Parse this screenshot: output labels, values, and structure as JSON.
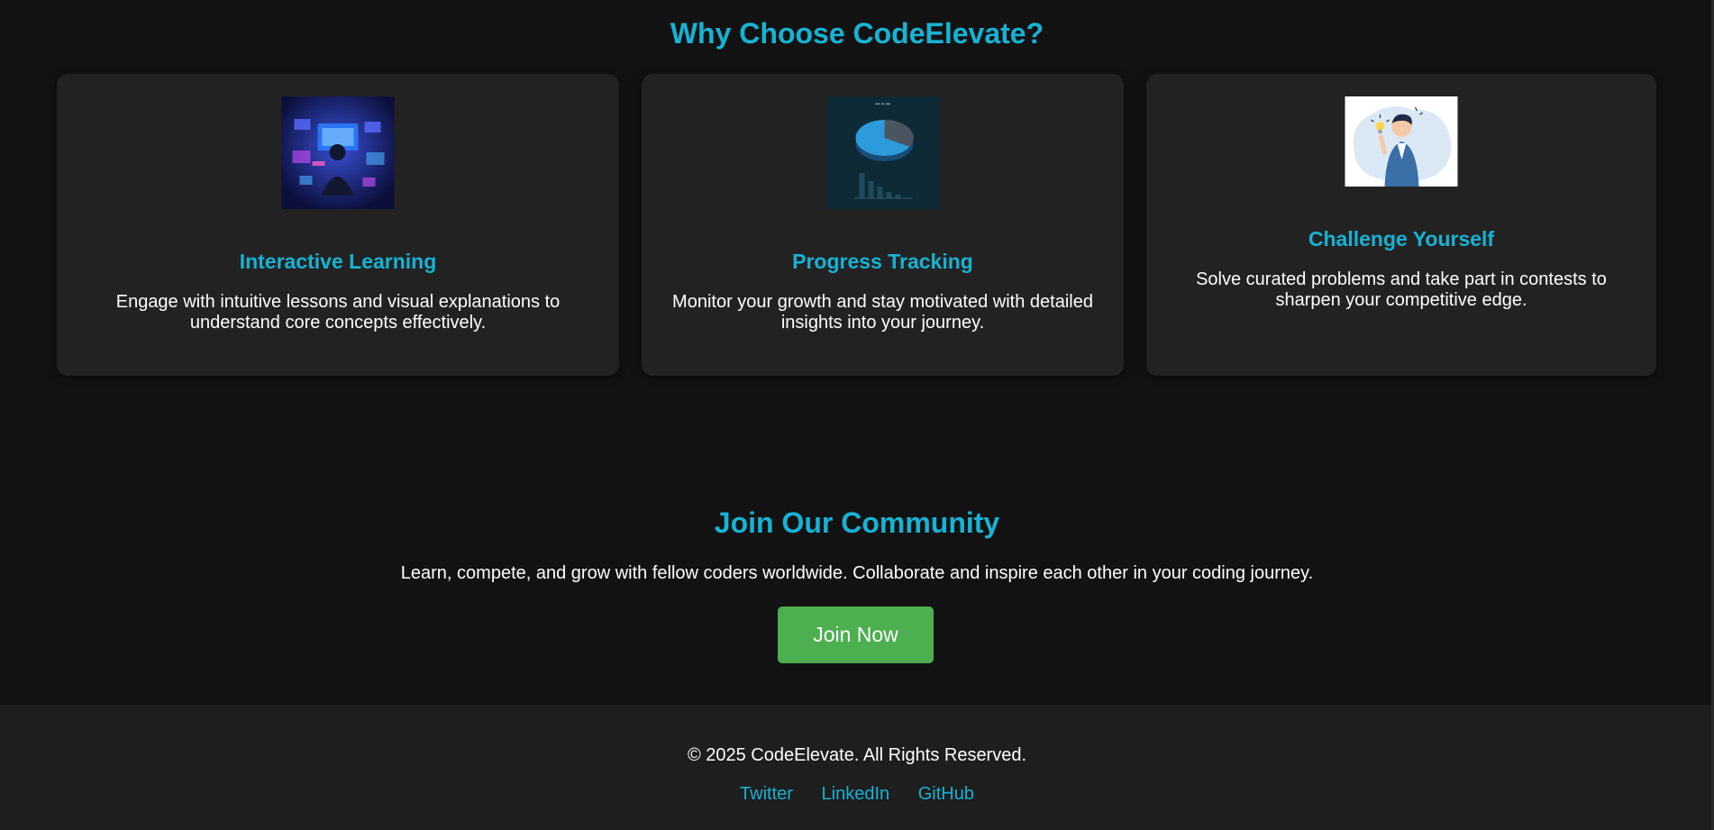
{
  "features": {
    "title": "Why Choose CodeElevate?",
    "cards": [
      {
        "title": "Interactive Learning",
        "description": "Engage with intuitive lessons and visual explanations to understand core concepts effectively.",
        "image_icon": "interactive-learning-illustration"
      },
      {
        "title": "Progress Tracking",
        "description": "Monitor your growth and stay motivated with detailed insights into your journey.",
        "image_icon": "progress-chart-illustration"
      },
      {
        "title": "Challenge Yourself",
        "description": "Solve curated problems and take part in contests to sharpen your competitive edge.",
        "image_icon": "idea-person-illustration"
      }
    ]
  },
  "community": {
    "title": "Join Our Community",
    "text": "Learn, compete, and grow with fellow coders worldwide. Collaborate and inspire each other in your coding journey.",
    "button_label": "Join Now"
  },
  "footer": {
    "copyright": "© 2025 CodeElevate. All Rights Reserved.",
    "links": [
      "Twitter",
      "LinkedIn",
      "GitHub"
    ]
  },
  "colors": {
    "background": "#121212",
    "card": "#222222",
    "accent": "#16b3d4",
    "button": "#4caf50",
    "footer": "#1e1e1e"
  }
}
